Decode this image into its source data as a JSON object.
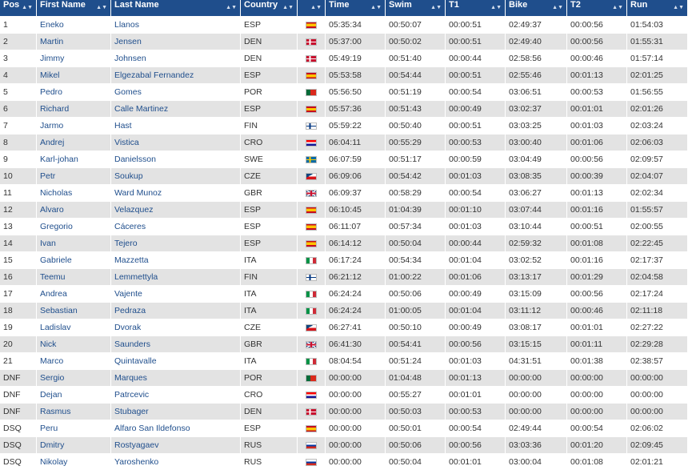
{
  "columns": [
    "Pos",
    "First Name",
    "Last Name",
    "Country",
    "",
    "Time",
    "Swim",
    "T1",
    "Bike",
    "T2",
    "Run"
  ],
  "sort_indicator": "▲▼",
  "rows": [
    {
      "pos": "1",
      "first": "Eneko",
      "last": "Llanos",
      "country": "ESP",
      "time": "05:35:34",
      "swim": "00:50:07",
      "t1": "00:00:51",
      "bike": "02:49:37",
      "t2": "00:00:56",
      "run": "01:54:03"
    },
    {
      "pos": "2",
      "first": "Martin",
      "last": "Jensen",
      "country": "DEN",
      "time": "05:37:00",
      "swim": "00:50:02",
      "t1": "00:00:51",
      "bike": "02:49:40",
      "t2": "00:00:56",
      "run": "01:55:31"
    },
    {
      "pos": "3",
      "first": "Jimmy",
      "last": "Johnsen",
      "country": "DEN",
      "time": "05:49:19",
      "swim": "00:51:40",
      "t1": "00:00:44",
      "bike": "02:58:56",
      "t2": "00:00:46",
      "run": "01:57:14"
    },
    {
      "pos": "4",
      "first": "Mikel",
      "last": "Elgezabal Fernandez",
      "country": "ESP",
      "time": "05:53:58",
      "swim": "00:54:44",
      "t1": "00:00:51",
      "bike": "02:55:46",
      "t2": "00:01:13",
      "run": "02:01:25"
    },
    {
      "pos": "5",
      "first": "Pedro",
      "last": "Gomes",
      "country": "POR",
      "time": "05:56:50",
      "swim": "00:51:19",
      "t1": "00:00:54",
      "bike": "03:06:51",
      "t2": "00:00:53",
      "run": "01:56:55"
    },
    {
      "pos": "6",
      "first": "Richard",
      "last": "Calle Martinez",
      "country": "ESP",
      "time": "05:57:36",
      "swim": "00:51:43",
      "t1": "00:00:49",
      "bike": "03:02:37",
      "t2": "00:01:01",
      "run": "02:01:26"
    },
    {
      "pos": "7",
      "first": "Jarmo",
      "last": "Hast",
      "country": "FIN",
      "time": "05:59:22",
      "swim": "00:50:40",
      "t1": "00:00:51",
      "bike": "03:03:25",
      "t2": "00:01:03",
      "run": "02:03:24"
    },
    {
      "pos": "8",
      "first": "Andrej",
      "last": "Vistica",
      "country": "CRO",
      "time": "06:04:11",
      "swim": "00:55:29",
      "t1": "00:00:53",
      "bike": "03:00:40",
      "t2": "00:01:06",
      "run": "02:06:03"
    },
    {
      "pos": "9",
      "first": "Karl-johan",
      "last": "Danielsson",
      "country": "SWE",
      "time": "06:07:59",
      "swim": "00:51:17",
      "t1": "00:00:59",
      "bike": "03:04:49",
      "t2": "00:00:56",
      "run": "02:09:57"
    },
    {
      "pos": "10",
      "first": "Petr",
      "last": "Soukup",
      "country": "CZE",
      "time": "06:09:06",
      "swim": "00:54:42",
      "t1": "00:01:03",
      "bike": "03:08:35",
      "t2": "00:00:39",
      "run": "02:04:07"
    },
    {
      "pos": "11",
      "first": "Nicholas",
      "last": "Ward Munoz",
      "country": "GBR",
      "time": "06:09:37",
      "swim": "00:58:29",
      "t1": "00:00:54",
      "bike": "03:06:27",
      "t2": "00:01:13",
      "run": "02:02:34"
    },
    {
      "pos": "12",
      "first": "Alvaro",
      "last": "Velazquez",
      "country": "ESP",
      "time": "06:10:45",
      "swim": "01:04:39",
      "t1": "00:01:10",
      "bike": "03:07:44",
      "t2": "00:01:16",
      "run": "01:55:57"
    },
    {
      "pos": "13",
      "first": "Gregorio",
      "last": "Cáceres",
      "country": "ESP",
      "time": "06:11:07",
      "swim": "00:57:34",
      "t1": "00:01:03",
      "bike": "03:10:44",
      "t2": "00:00:51",
      "run": "02:00:55"
    },
    {
      "pos": "14",
      "first": "Ivan",
      "last": "Tejero",
      "country": "ESP",
      "time": "06:14:12",
      "swim": "00:50:04",
      "t1": "00:00:44",
      "bike": "02:59:32",
      "t2": "00:01:08",
      "run": "02:22:45"
    },
    {
      "pos": "15",
      "first": "Gabriele",
      "last": "Mazzetta",
      "country": "ITA",
      "time": "06:17:24",
      "swim": "00:54:34",
      "t1": "00:01:04",
      "bike": "03:02:52",
      "t2": "00:01:16",
      "run": "02:17:37"
    },
    {
      "pos": "16",
      "first": "Teemu",
      "last": "Lemmettyla",
      "country": "FIN",
      "time": "06:21:12",
      "swim": "01:00:22",
      "t1": "00:01:06",
      "bike": "03:13:17",
      "t2": "00:01:29",
      "run": "02:04:58"
    },
    {
      "pos": "17",
      "first": "Andrea",
      "last": "Vajente",
      "country": "ITA",
      "time": "06:24:24",
      "swim": "00:50:06",
      "t1": "00:00:49",
      "bike": "03:15:09",
      "t2": "00:00:56",
      "run": "02:17:24"
    },
    {
      "pos": "18",
      "first": "Sebastian",
      "last": "Pedraza",
      "country": "ITA",
      "time": "06:24:24",
      "swim": "01:00:05",
      "t1": "00:01:04",
      "bike": "03:11:12",
      "t2": "00:00:46",
      "run": "02:11:18"
    },
    {
      "pos": "19",
      "first": "Ladislav",
      "last": "Dvorak",
      "country": "CZE",
      "time": "06:27:41",
      "swim": "00:50:10",
      "t1": "00:00:49",
      "bike": "03:08:17",
      "t2": "00:01:01",
      "run": "02:27:22"
    },
    {
      "pos": "20",
      "first": "Nick",
      "last": "Saunders",
      "country": "GBR",
      "time": "06:41:30",
      "swim": "00:54:41",
      "t1": "00:00:56",
      "bike": "03:15:15",
      "t2": "00:01:11",
      "run": "02:29:28"
    },
    {
      "pos": "21",
      "first": "Marco",
      "last": "Quintavalle",
      "country": "ITA",
      "time": "08:04:54",
      "swim": "00:51:24",
      "t1": "00:01:03",
      "bike": "04:31:51",
      "t2": "00:01:38",
      "run": "02:38:57"
    },
    {
      "pos": "DNF",
      "first": "Sergio",
      "last": "Marques",
      "country": "POR",
      "time": "00:00:00",
      "swim": "01:04:48",
      "t1": "00:01:13",
      "bike": "00:00:00",
      "t2": "00:00:00",
      "run": "00:00:00"
    },
    {
      "pos": "DNF",
      "first": "Dejan",
      "last": "Patrcevic",
      "country": "CRO",
      "time": "00:00:00",
      "swim": "00:55:27",
      "t1": "00:01:01",
      "bike": "00:00:00",
      "t2": "00:00:00",
      "run": "00:00:00"
    },
    {
      "pos": "DNF",
      "first": "Rasmus",
      "last": "Stubager",
      "country": "DEN",
      "time": "00:00:00",
      "swim": "00:50:03",
      "t1": "00:00:53",
      "bike": "00:00:00",
      "t2": "00:00:00",
      "run": "00:00:00"
    },
    {
      "pos": "DSQ",
      "first": "Peru",
      "last": "Alfaro San Ildefonso",
      "country": "ESP",
      "time": "00:00:00",
      "swim": "00:50:01",
      "t1": "00:00:54",
      "bike": "02:49:44",
      "t2": "00:00:54",
      "run": "02:06:02"
    },
    {
      "pos": "DSQ",
      "first": "Dmitry",
      "last": "Rostyagaev",
      "country": "RUS",
      "time": "00:00:00",
      "swim": "00:50:06",
      "t1": "00:00:56",
      "bike": "03:03:36",
      "t2": "00:01:20",
      "run": "02:09:45"
    },
    {
      "pos": "DSQ",
      "first": "Nikolay",
      "last": "Yaroshenko",
      "country": "RUS",
      "time": "00:00:00",
      "swim": "00:50:04",
      "t1": "00:01:01",
      "bike": "03:00:04",
      "t2": "00:01:08",
      "run": "02:01:21"
    }
  ]
}
